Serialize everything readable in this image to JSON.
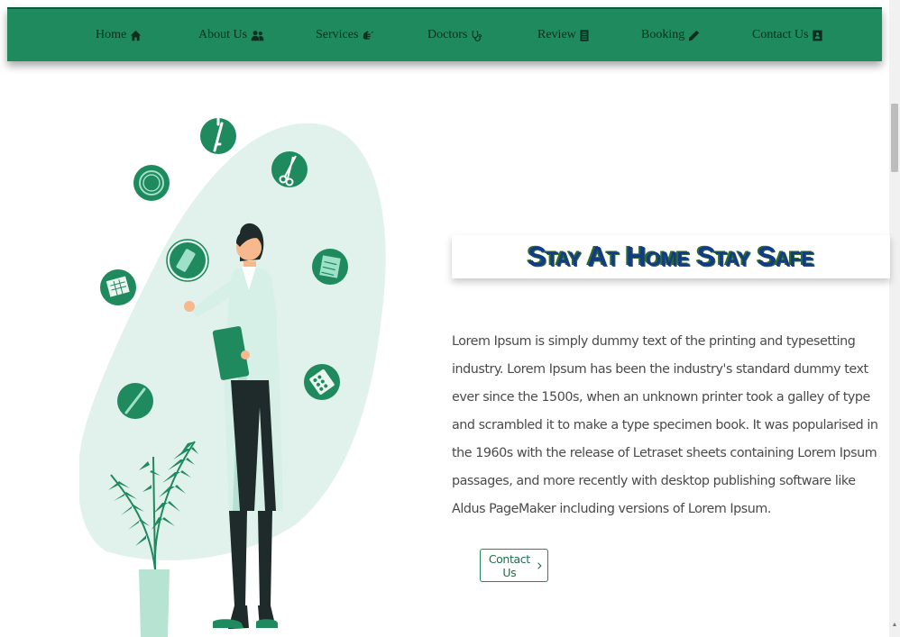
{
  "nav": {
    "items": [
      {
        "label": "Home",
        "icon": "home-icon"
      },
      {
        "label": "About Us",
        "icon": "users-icon"
      },
      {
        "label": "Services",
        "icon": "signing-hand-icon"
      },
      {
        "label": "Doctors",
        "icon": "stethoscope-icon"
      },
      {
        "label": "Review",
        "icon": "document-icon"
      },
      {
        "label": "Booking",
        "icon": "pencil-icon"
      },
      {
        "label": "Contact Us",
        "icon": "contact-card-icon"
      }
    ]
  },
  "hero": {
    "title": "Stay At Home Stay Safe",
    "paragraph": "Lorem Ipsum is simply dummy text of the printing and typesetting industry. Lorem Ipsum has been the industry's standard dummy text ever since the 1500s, when an unknown printer took a galley of type and scrambled it to make a type specimen book. It was popularised in the 1960s with the release of Letraset sheets containing Lorem Ipsum passages, and more recently with desktop publishing software like Aldus PageMaker including versions of Lorem Ipsum.",
    "cta_label": "Contact Us"
  },
  "colors": {
    "primary": "#1f8a5e",
    "title_text": "#123a8a",
    "title_shadow": "#2e6b2a",
    "blob": "#e1f2ec"
  }
}
